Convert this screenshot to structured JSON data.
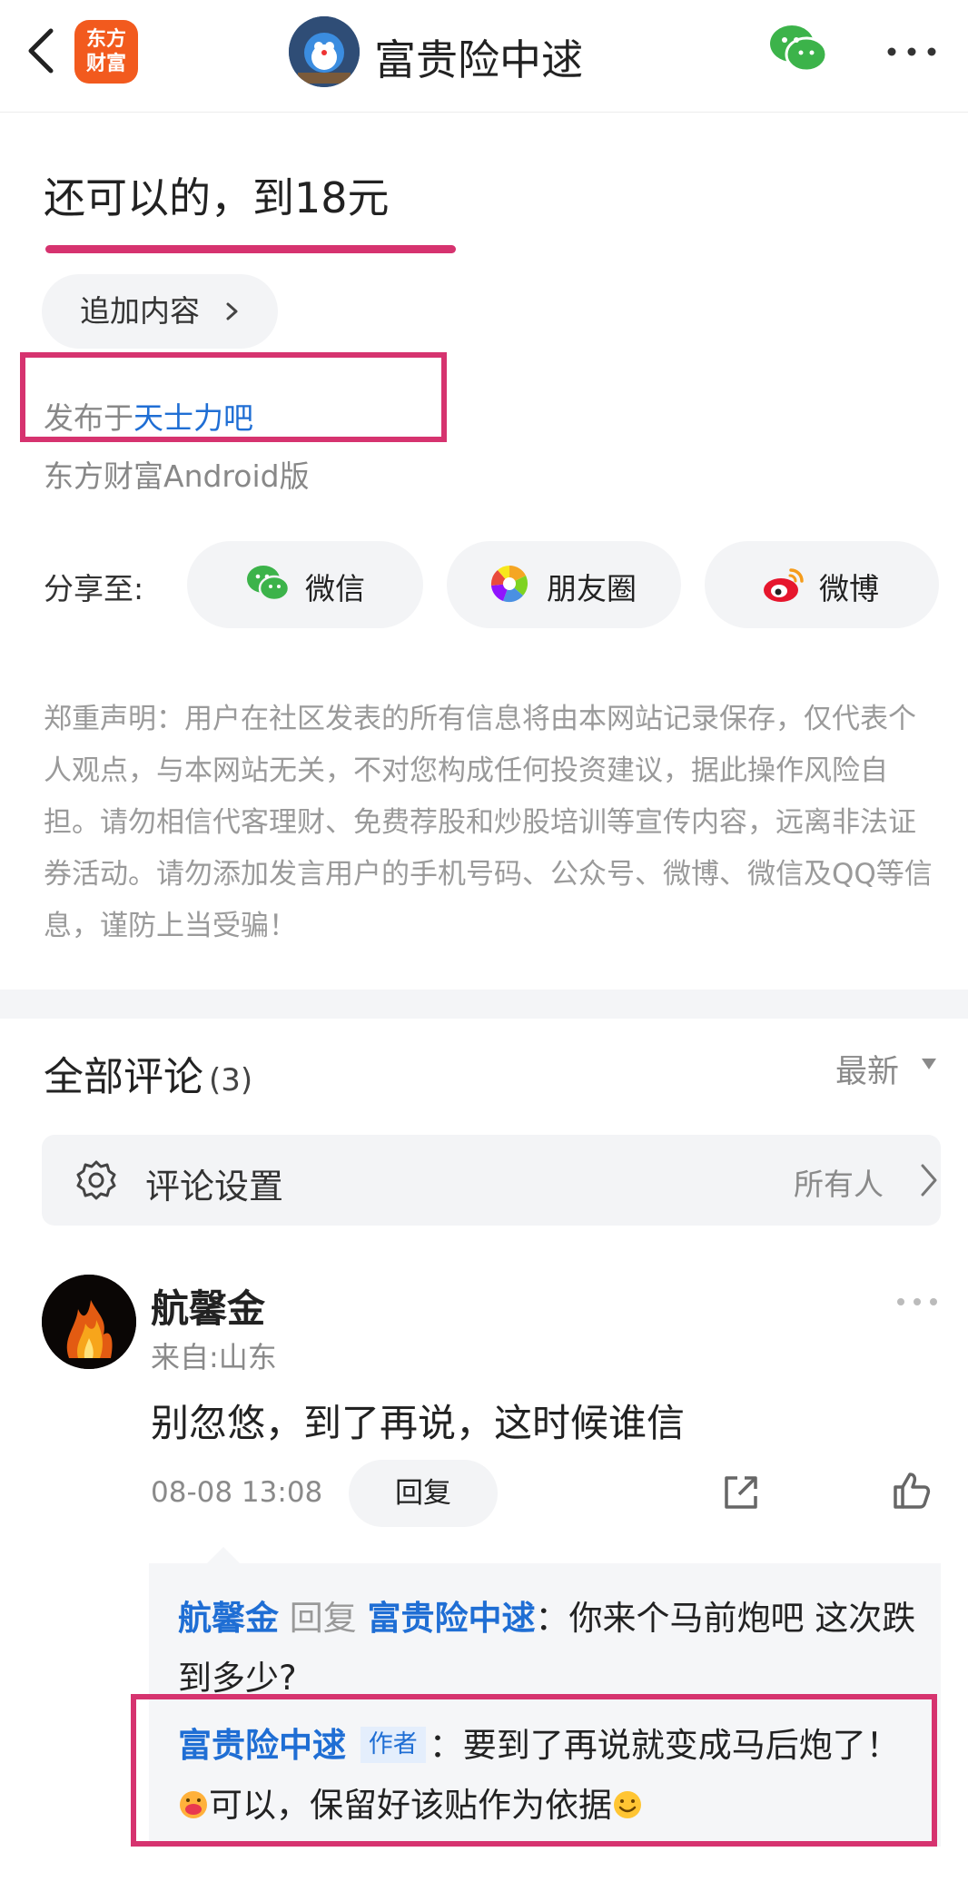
{
  "header": {
    "app_logo": "东方\n财富",
    "title": "富贵险中逑"
  },
  "post": {
    "title": "还可以的，到18元",
    "append_label": "追加内容",
    "posted_in_prefix": "发布于",
    "posted_in_bar": "天士力吧",
    "client": "东方财富Android版"
  },
  "share": {
    "label": "分享至:",
    "options": [
      {
        "label": "微信",
        "icon": "wechat-icon"
      },
      {
        "label": "朋友圈",
        "icon": "moments-icon"
      },
      {
        "label": "微博",
        "icon": "weibo-icon"
      }
    ]
  },
  "disclaimer": "郑重声明：用户在社区发表的所有信息将由本网站记录保存，仅代表个人观点，与本网站无关，不对您构成任何投资建议，据此操作风险自担。请勿相信代客理财、免费荐股和炒股培训等宣传内容，远离非法证券活动。请勿添加发言用户的手机号码、公众号、微博、微信及QQ等信息，谨防上当受骗！",
  "comments": {
    "title": "全部评论",
    "count": "(3)",
    "sort": "最新",
    "settings_label": "评论设置",
    "settings_value": "所有人",
    "items": [
      {
        "name": "航馨金",
        "from": "来自:山东",
        "body": "别忽悠，到了再说，这时候谁信",
        "time": "08-08 13:08",
        "reply_label": "回复",
        "replies": [
          {
            "name": "航馨金",
            "mid": "回复",
            "target": "富贵险中逑",
            "text": "：你来个马前炮吧 这次跌到多少?"
          },
          {
            "name": "富贵险中逑",
            "tag": "作者",
            "text1": "：要到了再说就变成马后炮了！",
            "text2": "可以，保留好该贴作为依据"
          }
        ]
      }
    ]
  },
  "colors": {
    "accent_red": "#d6336f",
    "link_blue": "#1f6ed4",
    "logo_orange": "#f25a1e",
    "wechat_green": "#3cb34a"
  }
}
